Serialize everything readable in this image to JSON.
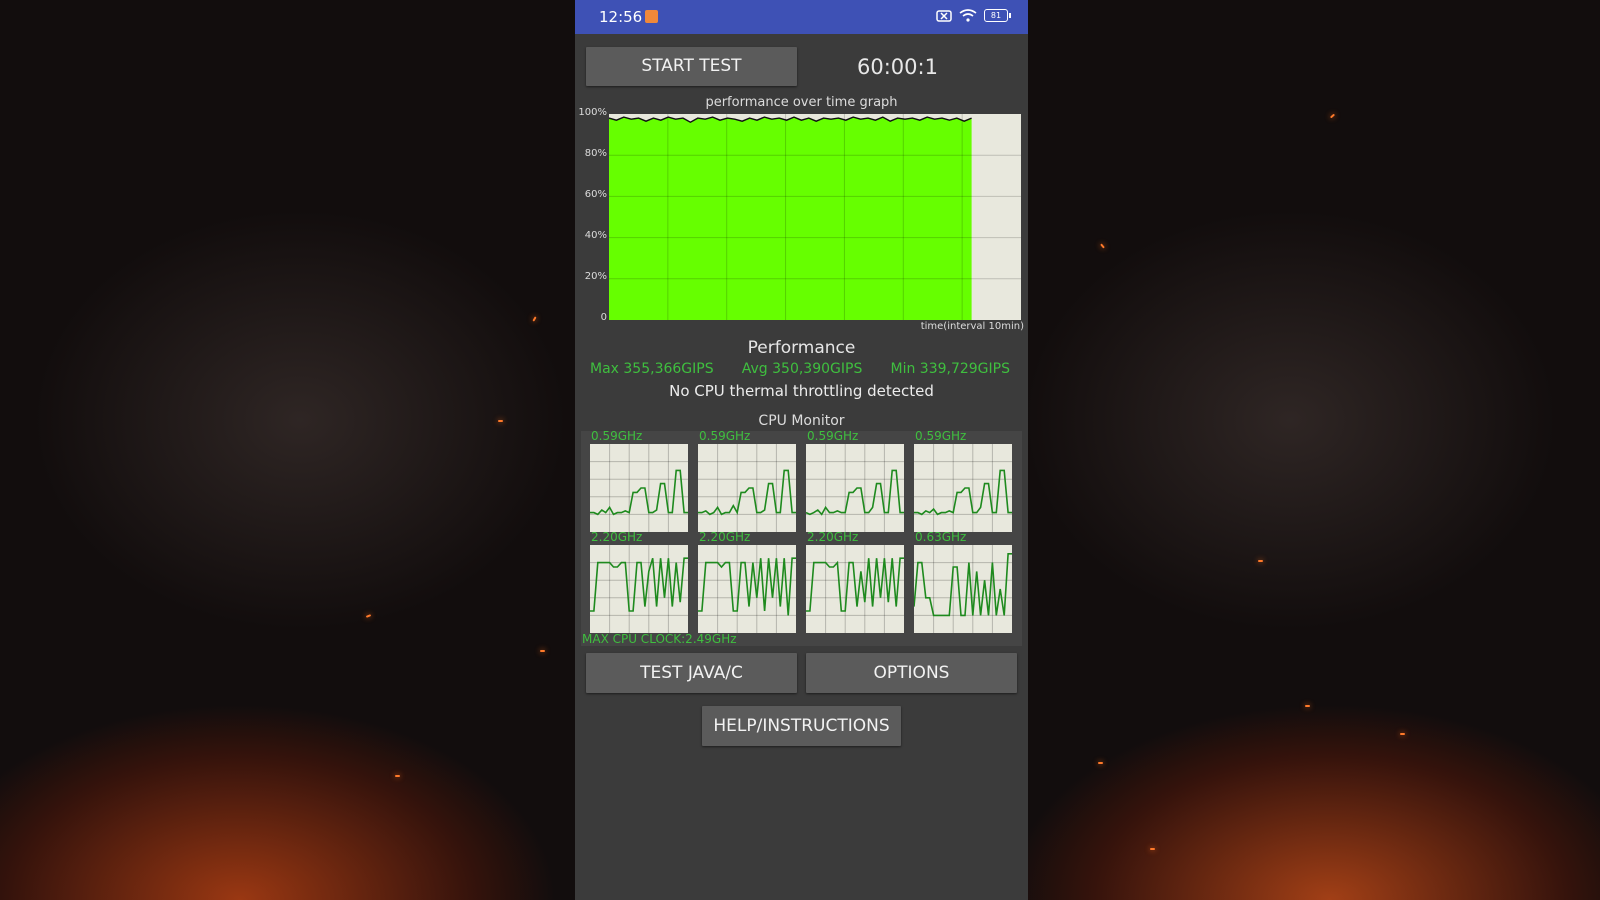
{
  "status_bar": {
    "time": "12:56",
    "battery": "81"
  },
  "toolbar": {
    "start_label": "START TEST",
    "timer": "60:00:1"
  },
  "graph": {
    "title": "performance over time graph",
    "y_ticks": [
      "100%",
      "80%",
      "60%",
      "40%",
      "20%",
      "0"
    ],
    "x_label": "time(interval 10min)"
  },
  "performance": {
    "title": "Performance",
    "max": "Max 355,366GIPS",
    "avg": "Avg 350,390GIPS",
    "min": "Min 339,729GIPS",
    "throttle_status": "No CPU thermal throttling detected"
  },
  "cpu_monitor": {
    "title": "CPU Monitor",
    "cores": [
      {
        "freq": "0.59GHz"
      },
      {
        "freq": "0.59GHz"
      },
      {
        "freq": "0.59GHz"
      },
      {
        "freq": "0.59GHz"
      },
      {
        "freq": "2.20GHz"
      },
      {
        "freq": "2.20GHz"
      },
      {
        "freq": "2.20GHz"
      },
      {
        "freq": "0.63GHz"
      }
    ],
    "max_clock": "MAX CPU CLOCK:2.49GHz"
  },
  "buttons": {
    "test_java_c": "TEST JAVA/C",
    "options": "OPTIONS",
    "help": "HELP/INSTRUCTIONS"
  },
  "colors": {
    "accent_green": "#3fbf3f",
    "graph_fill": "#66ff00",
    "status_bar": "#3e51b5"
  },
  "chart_data": {
    "type": "area",
    "title": "performance over time graph",
    "xlabel": "time(interval 10min)",
    "ylabel": "",
    "ylim": [
      0,
      100
    ],
    "x_end_fraction": 0.88,
    "values": [
      98,
      97,
      98.5,
      97.5,
      98,
      96.5,
      98,
      97,
      98.5,
      97.5,
      98,
      96,
      98,
      97.5,
      98.5,
      97,
      98,
      97.5,
      96.5,
      98,
      97,
      98.5,
      97.5,
      98,
      97,
      98.5,
      97,
      98,
      96.5,
      98,
      97.5,
      98,
      97,
      98.5,
      97.5,
      98,
      97,
      98.5,
      96.5,
      98,
      97.5,
      98,
      97,
      98.5,
      97.5,
      98,
      97,
      98,
      96.5,
      98
    ]
  }
}
